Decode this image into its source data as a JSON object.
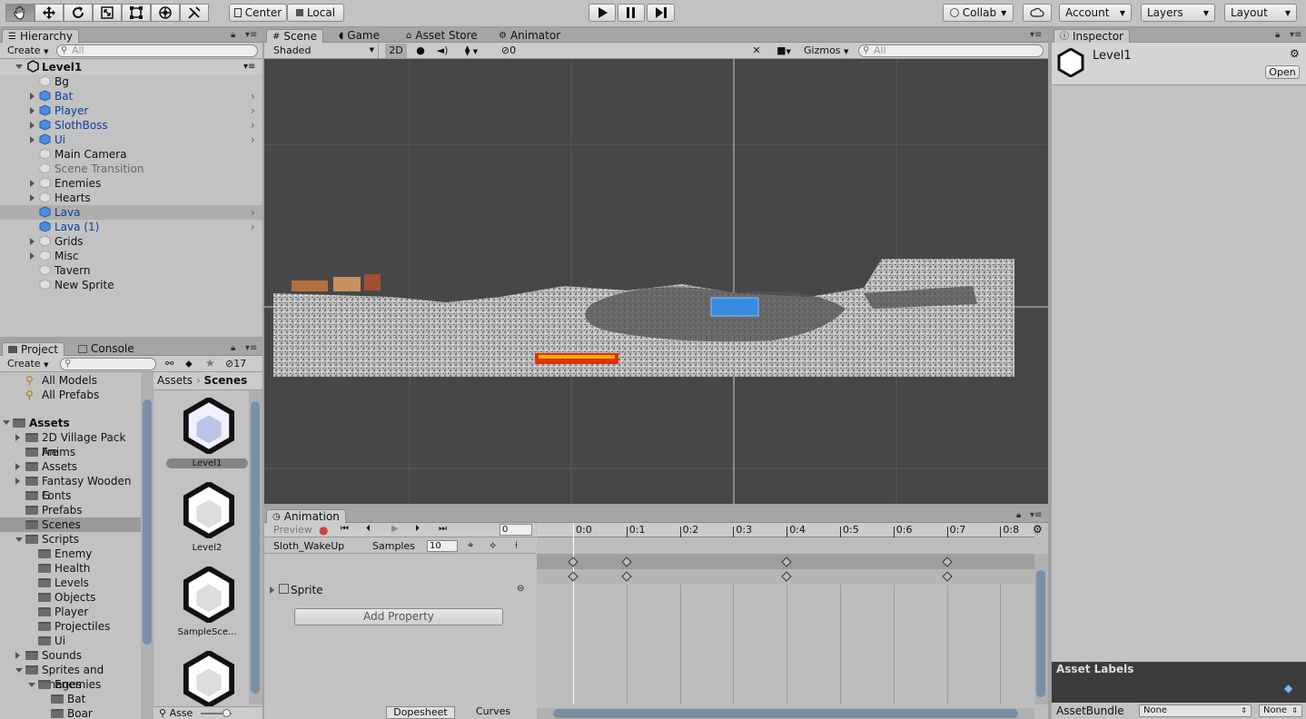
{
  "toolbar": {
    "tools": [
      "hand-tool",
      "move-tool",
      "rotate-tool",
      "scale-tool",
      "rect-tool",
      "transform-tool",
      "custom-tool"
    ],
    "center_label": "Center",
    "local_label": "Local",
    "collab_label": "Collab",
    "account_label": "Account",
    "layers_label": "Layers",
    "layout_label": "Layout"
  },
  "hierarchy": {
    "tab": "Hierarchy",
    "create": "Create",
    "search_placeholder": "All",
    "scene": "Level1",
    "items": [
      {
        "label": "Bg",
        "prefab": false,
        "expandable": false,
        "dim": false
      },
      {
        "label": "Bat",
        "prefab": true,
        "expandable": true,
        "dim": false
      },
      {
        "label": "Player",
        "prefab": true,
        "expandable": true,
        "dim": false
      },
      {
        "label": "SlothBoss",
        "prefab": true,
        "expandable": true,
        "dim": false
      },
      {
        "label": "Ui",
        "prefab": true,
        "expandable": true,
        "dim": false
      },
      {
        "label": "Main Camera",
        "prefab": false,
        "expandable": false,
        "dim": false
      },
      {
        "label": "Scene Transition",
        "prefab": false,
        "expandable": false,
        "dim": true
      },
      {
        "label": "Enemies",
        "prefab": false,
        "expandable": true,
        "dim": false
      },
      {
        "label": "Hearts",
        "prefab": false,
        "expandable": true,
        "dim": false
      },
      {
        "label": "Lava",
        "prefab": true,
        "expandable": false,
        "dim": false,
        "selected": true
      },
      {
        "label": "Lava (1)",
        "prefab": true,
        "expandable": false,
        "dim": false
      },
      {
        "label": "Grids",
        "prefab": false,
        "expandable": true,
        "dim": false
      },
      {
        "label": "Misc",
        "prefab": false,
        "expandable": true,
        "dim": false
      },
      {
        "label": "Tavern",
        "prefab": false,
        "expandable": false,
        "dim": false
      },
      {
        "label": "New Sprite",
        "prefab": false,
        "expandable": false,
        "dim": false
      }
    ]
  },
  "scene_view": {
    "tabs": [
      "Scene",
      "Game",
      "Asset Store",
      "Animator"
    ],
    "shading": "Shaded",
    "mode_2d": "2D",
    "fx_count": "0",
    "gizmos": "Gizmos",
    "search_placeholder": "All"
  },
  "inspector": {
    "tab": "Inspector",
    "title": "Level1",
    "open_label": "Open",
    "asset_labels": "Asset Labels",
    "assetbundle_label": "AssetBundle",
    "bundle_value": "None",
    "variant_value": "None"
  },
  "project": {
    "tabs": [
      "Project",
      "Console"
    ],
    "create": "Create",
    "count": "17",
    "favorites": [
      "All Models",
      "All Prefabs"
    ],
    "root": "Assets",
    "tree": [
      {
        "label": "2D Village Pack Fre",
        "depth": 1,
        "expandable": true
      },
      {
        "label": "Anims",
        "depth": 1,
        "expandable": false
      },
      {
        "label": "Assets",
        "depth": 1,
        "expandable": true
      },
      {
        "label": "Fantasy Wooden G",
        "depth": 1,
        "expandable": true
      },
      {
        "label": "Fonts",
        "depth": 1,
        "expandable": false
      },
      {
        "label": "Prefabs",
        "depth": 1,
        "expandable": false
      },
      {
        "label": "Scenes",
        "depth": 1,
        "expandable": false,
        "selected": true
      },
      {
        "label": "Scripts",
        "depth": 1,
        "expandable": true,
        "open": true
      },
      {
        "label": "Enemy",
        "depth": 2,
        "expandable": false
      },
      {
        "label": "Health",
        "depth": 2,
        "expandable": false
      },
      {
        "label": "Levels",
        "depth": 2,
        "expandable": false
      },
      {
        "label": "Objects",
        "depth": 2,
        "expandable": false
      },
      {
        "label": "Player",
        "depth": 2,
        "expandable": false
      },
      {
        "label": "Projectiles",
        "depth": 2,
        "expandable": false
      },
      {
        "label": "Ui",
        "depth": 2,
        "expandable": false
      },
      {
        "label": "Sounds",
        "depth": 1,
        "expandable": true
      },
      {
        "label": "Sprites and Images",
        "depth": 1,
        "expandable": true,
        "open": true
      },
      {
        "label": "Enemies",
        "depth": 2,
        "expandable": true,
        "open": true
      },
      {
        "label": "Bat",
        "depth": 3,
        "expandable": false
      },
      {
        "label": "Boar",
        "depth": 3,
        "expandable": false
      }
    ],
    "breadcrumb": [
      "Assets",
      "Scenes"
    ],
    "assets": [
      "Level1",
      "Level2",
      "SampleSce...",
      ""
    ],
    "footer_label": "Asse"
  },
  "animation": {
    "tab": "Animation",
    "preview": "Preview",
    "frame": "0",
    "clip": "Sloth_WakeUp",
    "samples_label": "Samples",
    "samples_value": "10",
    "property": "Sprite",
    "add_property": "Add Property",
    "ruler": [
      "0:0",
      "0:1",
      "0:2",
      "0:3",
      "0:4",
      "0:5",
      "0:6",
      "0:7",
      "0:8"
    ],
    "keyframes": [
      0,
      1,
      4,
      7
    ],
    "bottom_tabs": [
      "Dopesheet",
      "Curves"
    ]
  }
}
